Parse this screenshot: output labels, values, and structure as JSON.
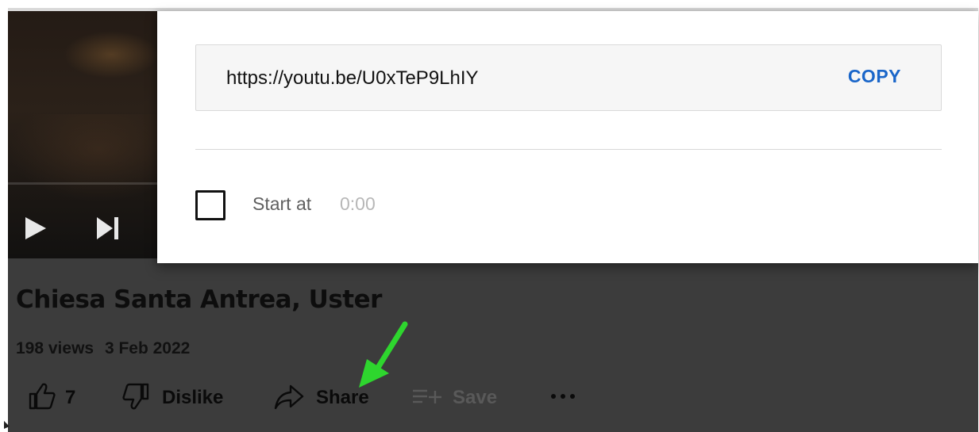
{
  "share_dialog": {
    "url": "https://youtu.be/U0xTeP9LhIY",
    "copy_label": "COPY",
    "start_at_label": "Start at",
    "start_time": "0:00",
    "start_checked": false
  },
  "video": {
    "title": "Chiesa Santa Antrea, Uster",
    "views": "198 views",
    "date": "3 Feb 2022"
  },
  "actions": {
    "like_count": "7",
    "dislike_label": "Dislike",
    "share_label": "Share",
    "save_label": "Save"
  },
  "icons": {
    "play": "play-icon",
    "next": "skip-next-icon",
    "like": "thumbs-up-icon",
    "dislike": "thumbs-down-icon",
    "share": "share-arrow-icon",
    "save": "playlist-add-icon",
    "more": "more-horizontal-icon"
  },
  "colors": {
    "copy_link": "#1a66c9",
    "annotation_arrow": "#2ed62e",
    "page_background": "#3c3c3c"
  }
}
